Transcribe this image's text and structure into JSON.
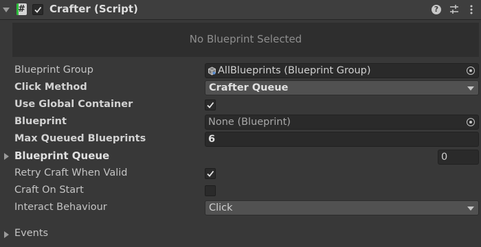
{
  "header": {
    "title": "Crafter (Script)",
    "script_icon_glyph": "#",
    "enabled": true,
    "icons": [
      "help-icon",
      "preset-icon",
      "kebab-menu-icon"
    ]
  },
  "preview": {
    "text": "No Blueprint Selected"
  },
  "properties": {
    "blueprint_group": {
      "label": "Blueprint Group",
      "value": "AllBlueprints (Blueprint Group)"
    },
    "click_method": {
      "label": "Click Method",
      "value": "Crafter Queue"
    },
    "use_global_container": {
      "label": "Use Global Container",
      "checked": true
    },
    "blueprint": {
      "label": "Blueprint",
      "value": "None (Blueprint)"
    },
    "max_queued_blueprints": {
      "label": "Max Queued Blueprints",
      "value": "6"
    },
    "blueprint_queue": {
      "label": "Blueprint Queue",
      "size": "0"
    },
    "retry_craft_when_valid": {
      "label": "Retry Craft When Valid",
      "checked": true
    },
    "craft_on_start": {
      "label": "Craft On Start",
      "checked": false
    },
    "interact_behaviour": {
      "label": "Interact Behaviour",
      "value": "Click"
    },
    "events": {
      "label": "Events"
    }
  },
  "colors": {
    "background": "#383838",
    "field": "#2a2a2a",
    "dropdown": "#515151",
    "script_accent": "#2bbf3a"
  }
}
